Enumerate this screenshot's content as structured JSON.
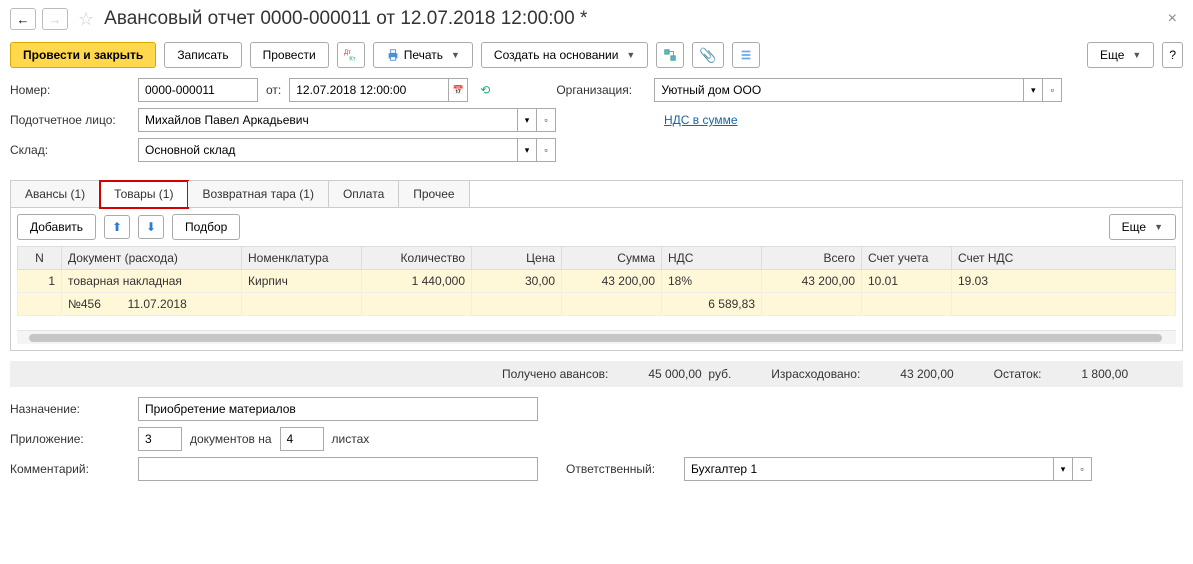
{
  "header": {
    "title": "Авансовый отчет 0000-000011 от 12.07.2018 12:00:00 *"
  },
  "toolbar": {
    "post_close": "Провести и закрыть",
    "save": "Записать",
    "post": "Провести",
    "print": "Печать",
    "create_based": "Создать на основании",
    "more": "Еще"
  },
  "form": {
    "number_label": "Номер:",
    "number": "0000-000011",
    "from_label": "от:",
    "date": "12.07.2018 12:00:00",
    "org_label": "Организация:",
    "org": "Уютный дом ООО",
    "person_label": "Подотчетное лицо:",
    "person": "Михайлов Павел Аркадьевич",
    "vat_link": "НДС в сумме",
    "warehouse_label": "Склад:",
    "warehouse": "Основной склад"
  },
  "tabs": {
    "advances": "Авансы (1)",
    "goods": "Товары (1)",
    "returnable": "Возвратная тара (1)",
    "payment": "Оплата",
    "other": "Прочее"
  },
  "goods_toolbar": {
    "add": "Добавить",
    "pick": "Подбор",
    "more": "Еще"
  },
  "columns": {
    "n": "N",
    "doc": "Документ (расхода)",
    "nomen": "Номенклатура",
    "qty": "Количество",
    "price": "Цена",
    "sum": "Сумма",
    "vat": "НДС",
    "total": "Всего",
    "acct": "Счет учета",
    "vat_acct": "Счет НДС"
  },
  "rows": [
    {
      "n": "1",
      "doc": "товарная накладная",
      "doc_no": "№456",
      "doc_date": "11.07.2018",
      "nomen": "Кирпич",
      "qty": "1 440,000",
      "price": "30,00",
      "sum": "43 200,00",
      "vat": "18%",
      "vat_amount": "6 589,83",
      "total": "43 200,00",
      "acct": "10.01",
      "vat_acct": "19.03"
    }
  ],
  "summary": {
    "received_label": "Получено авансов:",
    "received": "45 000,00",
    "currency": "руб.",
    "spent_label": "Израсходовано:",
    "spent": "43 200,00",
    "remainder_label": "Остаток:",
    "remainder": "1 800,00"
  },
  "bottom": {
    "purpose_label": "Назначение:",
    "purpose": "Приобретение материалов",
    "attachment_label": "Приложение:",
    "docs_count": "3",
    "docs_word": "документов на",
    "sheets_count": "4",
    "sheets_word": "листах",
    "comment_label": "Комментарий:",
    "comment": "",
    "responsible_label": "Ответственный:",
    "responsible": "Бухгалтер 1"
  }
}
